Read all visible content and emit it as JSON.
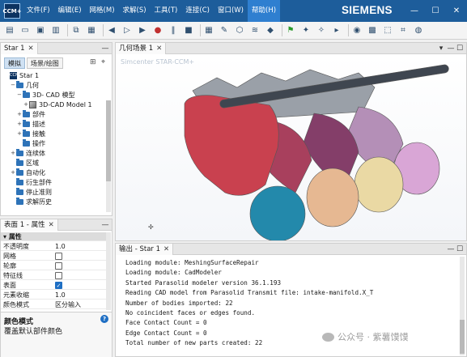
{
  "app": {
    "logo_text": "CCM+",
    "brand": "SIEMENS",
    "menu": [
      "文件(F)",
      "编辑(E)",
      "网格(M)",
      "求解(S)",
      "工具(T)",
      "连接(C)",
      "窗口(W)",
      "帮助(H)"
    ],
    "active_menu_index": 7,
    "window_controls": {
      "minimize": "—",
      "maximize": "☐",
      "close": "✕"
    }
  },
  "toolbar": {
    "icons": [
      "new-file",
      "open-folder",
      "save",
      "save-as",
      "copy",
      "paste",
      "step-back",
      "step-forward",
      "run",
      "record",
      "pause",
      "stop",
      "mesh",
      "repair",
      "cad",
      "layers",
      "shapes",
      "flag",
      "walk",
      "run-fast",
      "play-step",
      "camera",
      "grid",
      "select",
      "fit",
      "render"
    ]
  },
  "tree_panel": {
    "title": "Star 1",
    "subtabs": [
      "模拟",
      "场景/绘图"
    ],
    "nodes": [
      {
        "label": "Star 1",
        "depth": 0,
        "expander": "",
        "icon": "star-badge"
      },
      {
        "label": "几何",
        "depth": 1,
        "expander": "−",
        "icon": "folder"
      },
      {
        "label": "3D- CAD 模型",
        "depth": 2,
        "expander": "−",
        "icon": "folder"
      },
      {
        "label": "3D-CAD Model 1",
        "depth": 3,
        "expander": "+",
        "icon": "cube"
      },
      {
        "label": "部件",
        "depth": 2,
        "expander": "+",
        "icon": "folder"
      },
      {
        "label": "描述",
        "depth": 2,
        "expander": "+",
        "icon": "folder"
      },
      {
        "label": "接触",
        "depth": 2,
        "expander": "+",
        "icon": "folder"
      },
      {
        "label": "操作",
        "depth": 2,
        "expander": "",
        "icon": "folder"
      },
      {
        "label": "连续体",
        "depth": 1,
        "expander": "+",
        "icon": "folder"
      },
      {
        "label": "区域",
        "depth": 1,
        "expander": "",
        "icon": "folder"
      },
      {
        "label": "自动化",
        "depth": 1,
        "expander": "+",
        "icon": "folder"
      },
      {
        "label": "衍生部件",
        "depth": 1,
        "expander": "",
        "icon": "folder"
      },
      {
        "label": "停止准则",
        "depth": 1,
        "expander": "",
        "icon": "folder"
      },
      {
        "label": "求解历史",
        "depth": 1,
        "expander": "",
        "icon": "folder"
      }
    ]
  },
  "props_panel": {
    "title": "表面 1 - 属性",
    "group": "属性",
    "rows": [
      {
        "name": "不透明度",
        "type": "text",
        "value": "1.0"
      },
      {
        "name": "网格",
        "type": "check",
        "checked": false
      },
      {
        "name": "轮廓",
        "type": "check",
        "checked": false
      },
      {
        "name": "特征线",
        "type": "check",
        "checked": false
      },
      {
        "name": "表面",
        "type": "check",
        "checked": true
      },
      {
        "name": "元素收缩",
        "type": "text",
        "value": "1.0"
      },
      {
        "name": "颜色模式",
        "type": "text",
        "value": "区分输入"
      }
    ],
    "desc_title": "颜色模式",
    "desc_text": "覆盖默认部件颜色",
    "help_icon": "?"
  },
  "scene_panel": {
    "title": "几何场景 1",
    "watermark": "Simcenter STAR-CCM+",
    "colors": {
      "manifold": "#c9414f",
      "bracket": "#9aa0a8",
      "rod": "#3f4650",
      "bell1": "#2389ab",
      "bell2": "#e6b892",
      "bell3": "#ead9a4",
      "bell4": "#d9a6d6",
      "body2": "#a8405d",
      "body3": "#843e69",
      "body4": "#b48fb7"
    }
  },
  "output_panel": {
    "title": "输出 - Star 1",
    "lines": [
      "Loading module: MeshingSurfaceRepair",
      "Loading module: CadModeler",
      "Started Parasolid modeler version 36.1.193",
      "Reading CAD model from Parasolid Transmit file: intake-manifold.X_T",
      "Number of bodies imported: 22",
      "No coincident faces or edges found.",
      "Face Contact Count = 0",
      "Edge Contact Count = 0",
      "Total number of new parts created: 22"
    ]
  },
  "overlay": {
    "wechat_text": "公众号 · 紫薯馍馍"
  }
}
